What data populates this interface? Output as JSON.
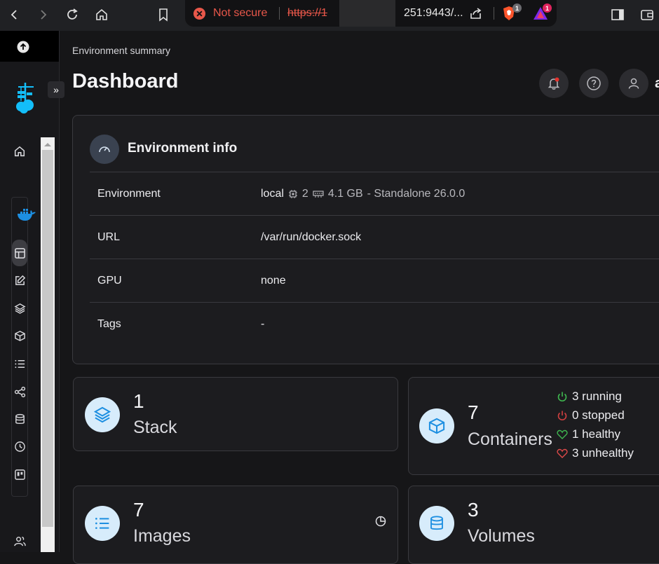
{
  "browser": {
    "security_label": "Not secure",
    "url_scheme": "https://1",
    "url_rest": "251:9443/...",
    "brave_badge": "1",
    "rewards_badge": "1",
    "colors": {
      "warning": "#e8574a",
      "brave": "#fb542b"
    }
  },
  "header": {
    "breadcrumb": "Environment summary",
    "title": "Dashboard",
    "user_initial": "a"
  },
  "env_info": {
    "title": "Environment info",
    "rows": [
      {
        "key": "Environment",
        "value": "local",
        "cpu": "2",
        "mem": "4.1 GB",
        "detail": "- Standalone 26.0.0"
      },
      {
        "key": "URL",
        "value": "/var/run/docker.sock"
      },
      {
        "key": "GPU",
        "value": "none"
      },
      {
        "key": "Tags",
        "value": "-"
      }
    ]
  },
  "stats": {
    "stack": {
      "count": "1",
      "label": "Stack"
    },
    "containers": {
      "count": "7",
      "label": "Containers",
      "running": "3 running",
      "stopped": "0 stopped",
      "healthy": "1 healthy",
      "unhealthy": "3 unhealthy"
    },
    "images": {
      "count": "7",
      "label": "Images"
    },
    "volumes": {
      "count": "3",
      "label": "Volumes"
    }
  },
  "colors": {
    "accent": "#1d8fe1",
    "running": "#3fb950",
    "stopped": "#d04040",
    "healthy": "#3fb950",
    "unhealthy": "#e04a4a"
  }
}
